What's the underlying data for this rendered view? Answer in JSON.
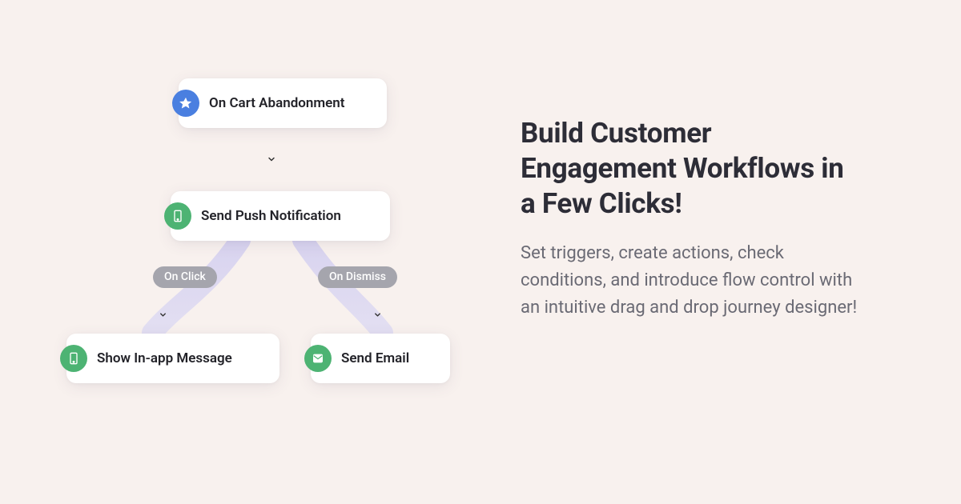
{
  "hero": {
    "headline": "Build Customer Engagement Workflows in a Few Clicks!",
    "body": "Set triggers, create actions, check conditions, and introduce flow control with an intuitive drag and drop journey designer!"
  },
  "workflow": {
    "nodes": {
      "trigger": {
        "label": "On Cart Abandonment"
      },
      "push": {
        "label": "Send Push Notification"
      },
      "inapp": {
        "label": "Show In-app Message"
      },
      "email": {
        "label": "Send Email"
      }
    },
    "branches": {
      "click": {
        "label": "On Click"
      },
      "dismiss": {
        "label": "On Dismiss"
      }
    }
  }
}
